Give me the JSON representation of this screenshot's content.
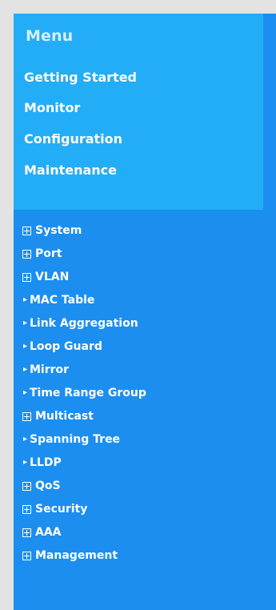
{
  "menu": {
    "title": "Menu",
    "top_links": [
      "Getting Started",
      "Monitor",
      "Configuration",
      "Maintenance"
    ]
  },
  "tree": {
    "items": [
      {
        "label": "System",
        "type": "parent",
        "icon": "plus-box-icon"
      },
      {
        "label": "Port",
        "type": "parent",
        "icon": "plus-box-icon"
      },
      {
        "label": "VLAN",
        "type": "parent",
        "icon": "plus-box-icon"
      },
      {
        "label": "MAC Table",
        "type": "child",
        "icon": "arrow-icon"
      },
      {
        "label": "Link Aggregation",
        "type": "child",
        "icon": "arrow-icon"
      },
      {
        "label": "Loop Guard",
        "type": "child",
        "icon": "arrow-icon"
      },
      {
        "label": "Mirror",
        "type": "child",
        "icon": "arrow-icon"
      },
      {
        "label": "Time Range Group",
        "type": "child",
        "icon": "arrow-icon"
      },
      {
        "label": "Multicast",
        "type": "parent",
        "icon": "plus-box-icon"
      },
      {
        "label": "Spanning Tree",
        "type": "child",
        "icon": "arrow-icon"
      },
      {
        "label": "LLDP",
        "type": "child",
        "icon": "arrow-icon"
      },
      {
        "label": "QoS",
        "type": "parent",
        "icon": "plus-box-icon"
      },
      {
        "label": "Security",
        "type": "parent",
        "icon": "plus-box-icon"
      },
      {
        "label": "AAA",
        "type": "parent",
        "icon": "plus-box-icon"
      },
      {
        "label": "Management",
        "type": "parent",
        "icon": "plus-box-icon"
      }
    ]
  },
  "colors": {
    "outer_background": "#e3e3e3",
    "top_panel": "#23adf6",
    "tree_panel": "#1c8ef0",
    "title_text": "#d7f0ff",
    "item_text": "#ffffff"
  }
}
